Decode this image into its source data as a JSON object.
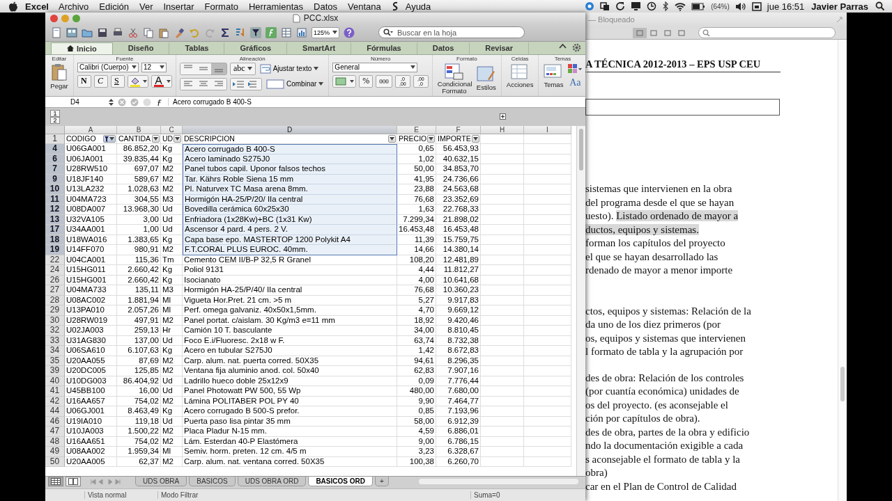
{
  "menubar": {
    "app": "Excel",
    "items": [
      "Archivo",
      "Edición",
      "Ver",
      "Insertar",
      "Formato",
      "Herramientas",
      "Datos",
      "Ventana",
      "Ayuda"
    ],
    "battery": "(64%)",
    "clock": "jue 16:51",
    "user": "Javier Parras"
  },
  "excel": {
    "title": "PCC.xlsx",
    "zoom": "125%",
    "search_placeholder": "Buscar en la hoja",
    "ribbon_tabs": [
      {
        "label": "Inicio",
        "selected": true
      },
      {
        "label": "Diseño",
        "selected": false
      },
      {
        "label": "Tablas",
        "selected": false
      },
      {
        "label": "Gráficos",
        "selected": false
      },
      {
        "label": "SmartArt",
        "selected": false
      },
      {
        "label": "Fórmulas",
        "selected": false
      },
      {
        "label": "Datos",
        "selected": false
      },
      {
        "label": "Revisar",
        "selected": false
      }
    ],
    "ribbon_groups": [
      {
        "kind": "edit",
        "label": "Editar",
        "paste": "Pegar"
      },
      {
        "kind": "font",
        "label": "Fuente",
        "font": "Calibri (Cuerpo)",
        "size": "12",
        "styles": [
          "N",
          "C",
          "S"
        ]
      },
      {
        "kind": "alignment",
        "label": "Alineación",
        "orientation": "abc",
        "wrap": "Ajustar texto",
        "merge": "Combinar"
      },
      {
        "kind": "number",
        "label": "Número",
        "format": "General",
        "percent": "%",
        "thousands": "000",
        "decimals": [
          {
            "top": ",0",
            "bottom": ",00"
          },
          {
            "top": ",00",
            "bottom": ",0"
          }
        ]
      },
      {
        "kind": "format",
        "label": "Formato",
        "conditional": "Condicional Formato",
        "styles": "Estilos"
      },
      {
        "kind": "cells",
        "label": "Celdas",
        "actions": "Acciones"
      },
      {
        "kind": "themes",
        "label": "Temas",
        "themes": "Temas",
        "fonts": "Aa"
      }
    ],
    "formula_bar": {
      "cell": "D4",
      "formula": "Acero corrugado B 400-S"
    },
    "outline_levels": [
      "1",
      "2"
    ],
    "columns": [
      {
        "letter": "A",
        "selected": false
      },
      {
        "letter": "B",
        "selected": false
      },
      {
        "letter": "C",
        "selected": false
      },
      {
        "letter": "D",
        "selected": true
      },
      {
        "letter": "E",
        "selected": false
      },
      {
        "letter": "F",
        "selected": false
      },
      {
        "letter": "H",
        "selected": false
      },
      {
        "letter": "I",
        "selected": false
      }
    ],
    "header_row": {
      "number": "1",
      "cells": [
        {
          "text": "CODIGO",
          "filtered": true
        },
        {
          "text": "CANTIDA",
          "filtered": false
        },
        {
          "text": "UD",
          "filtered": false
        },
        {
          "text": "DESCRIPCION",
          "filtered": false
        },
        {
          "text": "PRECIO",
          "filtered": false
        },
        {
          "text": "IMPORTE",
          "filtered": false
        }
      ]
    },
    "rows": [
      {
        "number": "4",
        "codigo": "U06GA001",
        "cantidad": "86.852,20",
        "ud": "Kg",
        "descripcion": "Acero corrugado B 400-S",
        "precio": "0,65",
        "importe": "56.453,93",
        "selected": true
      },
      {
        "number": "6",
        "codigo": "U06JA001",
        "cantidad": "39.835,44",
        "ud": "Kg",
        "descripcion": "Acero laminado S275J0",
        "precio": "1,02",
        "importe": "40.632,15",
        "selected": true
      },
      {
        "number": "7",
        "codigo": "U28RW510",
        "cantidad": "697,07",
        "ud": "M2",
        "descripcion": "Panel tubos capil. Uponor falsos techos",
        "precio": "50,00",
        "importe": "34.853,70",
        "selected": true
      },
      {
        "number": "9",
        "codigo": "U18JF140",
        "cantidad": "589,67",
        "ud": "M2",
        "descripcion": "Tar. Kährs Roble Siena 15 mm",
        "precio": "41,95",
        "importe": "24.736,66",
        "selected": true
      },
      {
        "number": "10",
        "codigo": "U13LA232",
        "cantidad": "1.028,63",
        "ud": "M2",
        "descripcion": "Pl. Naturvex TC Masa arena 8mm.",
        "precio": "23,88",
        "importe": "24.563,68",
        "selected": true
      },
      {
        "number": "11",
        "codigo": "U04MA723",
        "cantidad": "304,55",
        "ud": "M3",
        "descripcion": "Hormigón HA-25/P/20/ IIa central",
        "precio": "76,68",
        "importe": "23.352,69",
        "selected": true
      },
      {
        "number": "12",
        "codigo": "U08DA007",
        "cantidad": "13.968,30",
        "ud": "Ud",
        "descripcion": "Bovedilla cerámica 60x25x30",
        "precio": "1,63",
        "importe": "22.768,33",
        "selected": true
      },
      {
        "number": "13",
        "codigo": "U32VA105",
        "cantidad": "3,00",
        "ud": "Ud",
        "descripcion": "Enfriadora (1x28Kw)+BC (1x31 Kw)",
        "precio": "7.299,34",
        "importe": "21.898,02",
        "selected": true
      },
      {
        "number": "17",
        "codigo": "U34AA001",
        "cantidad": "1,00",
        "ud": "Ud",
        "descripcion": "Ascensor 4 pard. 4 pers. 2 V.",
        "precio": "16.453,48",
        "importe": "16.453,48",
        "selected": true
      },
      {
        "number": "18",
        "codigo": "U18WA016",
        "cantidad": "1.383,65",
        "ud": "Kg",
        "descripcion": "Capa base epo. MASTERTOP 1200 Polykit A4",
        "precio": "11,39",
        "importe": "15.759,75",
        "selected": true
      },
      {
        "number": "19",
        "codigo": "U14FF070",
        "cantidad": "980,91",
        "ud": "M2",
        "descripcion": "F.T.CORAL PLUS EUROC. 40mm.",
        "precio": "14,66",
        "importe": "14.380,14",
        "selected": true
      },
      {
        "number": "22",
        "codigo": "U04CA001",
        "cantidad": "115,36",
        "ud": "Tm",
        "descripcion": "Cemento CEM II/B-P 32,5 R Granel",
        "precio": "108,20",
        "importe": "12.481,89",
        "selected": false
      },
      {
        "number": "24",
        "codigo": "U15HG011",
        "cantidad": "2.660,42",
        "ud": "Kg",
        "descripcion": "Poliol 9131",
        "precio": "4,44",
        "importe": "11.812,27",
        "selected": false
      },
      {
        "number": "26",
        "codigo": "U15HG001",
        "cantidad": "2.660,42",
        "ud": "Kg",
        "descripcion": "Isocianato",
        "precio": "4,00",
        "importe": "10.641,68",
        "selected": false
      },
      {
        "number": "27",
        "codigo": "U04MA733",
        "cantidad": "135,11",
        "ud": "M3",
        "descripcion": "Hormigón HA-25/P/40/ IIa central",
        "precio": "76,68",
        "importe": "10.360,23",
        "selected": false
      },
      {
        "number": "28",
        "codigo": "U08AC002",
        "cantidad": "1.881,94",
        "ud": "Ml",
        "descripcion": "Vigueta Hor.Pret. 21 cm. >5 m",
        "precio": "5,27",
        "importe": "9.917,83",
        "selected": false
      },
      {
        "number": "29",
        "codigo": "U13PA010",
        "cantidad": "2.057,26",
        "ud": "Ml",
        "descripcion": "Perf. omega galvaniz. 40x50x1,5mm.",
        "precio": "4,70",
        "importe": "9.669,12",
        "selected": false
      },
      {
        "number": "30",
        "codigo": "U28RW019",
        "cantidad": "497,91",
        "ud": "M2",
        "descripcion": "Panel portat. c/aislam. 30 Kg/m3 e=11 mm",
        "precio": "18,92",
        "importe": "9.420,46",
        "selected": false
      },
      {
        "number": "32",
        "codigo": "U02JA003",
        "cantidad": "259,13",
        "ud": "Hr",
        "descripcion": "Camión 10  T. basculante",
        "precio": "34,00",
        "importe": "8.810,45",
        "selected": false
      },
      {
        "number": "33",
        "codigo": "U31AG830",
        "cantidad": "137,00",
        "ud": "Ud",
        "descripcion": "Foco E.i/Fluoresc. 2x18 w F.",
        "precio": "63,74",
        "importe": "8.732,38",
        "selected": false
      },
      {
        "number": "34",
        "codigo": "U06SA610",
        "cantidad": "6.107,63",
        "ud": "Kg",
        "descripcion": "Acero en tubular S275J0",
        "precio": "1,42",
        "importe": "8.672,83",
        "selected": false
      },
      {
        "number": "35",
        "codigo": "U20AA055",
        "cantidad": "87,69",
        "ud": "M2",
        "descripcion": "Carp. alum. nat. puerta corred. 50X35",
        "precio": "94,61",
        "importe": "8.296,35",
        "selected": false
      },
      {
        "number": "39",
        "codigo": "U20DC005",
        "cantidad": "125,85",
        "ud": "M2",
        "descripcion": "Ventana fija aluminio anod. col. 50x40",
        "precio": "62,83",
        "importe": "7.907,16",
        "selected": false
      },
      {
        "number": "40",
        "codigo": "U10DG003",
        "cantidad": "86.404,92",
        "ud": "Ud",
        "descripcion": "Ladrillo hueco doble 25x12x9",
        "precio": "0,09",
        "importe": "7.776,44",
        "selected": false
      },
      {
        "number": "41",
        "codigo": "U45BB100",
        "cantidad": "16,00",
        "ud": "Ud",
        "descripcion": "Panel Photowatt PW 500, 55 Wp",
        "precio": "480,00",
        "importe": "7.680,00",
        "selected": false
      },
      {
        "number": "42",
        "codigo": "U16AA657",
        "cantidad": "754,02",
        "ud": "M2",
        "descripcion": "Lámina POLITABER POL PY 40",
        "precio": "9,90",
        "importe": "7.464,77",
        "selected": false
      },
      {
        "number": "44",
        "codigo": "U06GJ001",
        "cantidad": "8.463,49",
        "ud": "Kg",
        "descripcion": "Acero corrugado B 500-S prefor.",
        "precio": "0,85",
        "importe": "7.193,96",
        "selected": false
      },
      {
        "number": "46",
        "codigo": "U19IA010",
        "cantidad": "119,18",
        "ud": "Ud",
        "descripcion": "Puerta paso lisa pintar 35 mm",
        "precio": "58,00",
        "importe": "6.912,39",
        "selected": false
      },
      {
        "number": "47",
        "codigo": "U10JA003",
        "cantidad": "1.500,22",
        "ud": "M2",
        "descripcion": "Placa Pladur N-15 mm.",
        "precio": "4,59",
        "importe": "6.886,01",
        "selected": false
      },
      {
        "number": "48",
        "codigo": "U16AA651",
        "cantidad": "754,02",
        "ud": "M2",
        "descripcion": "Lám. Esterdan 40-P Elastómera",
        "precio": "9,00",
        "importe": "6.786,15",
        "selected": false
      },
      {
        "number": "49",
        "codigo": "U08AA002",
        "cantidad": "1.959,34",
        "ud": "Ml",
        "descripcion": "Semiv. horm. preten. 12 cm. 4/5 m",
        "precio": "3,23",
        "importe": "6.328,67",
        "selected": false
      },
      {
        "number": "50",
        "codigo": "U20AA005",
        "cantidad": "62,37",
        "ud": "M2",
        "descripcion": "Carp. alum. nat. ventana corred. 50X35",
        "precio": "100,38",
        "importe": "6.260,70",
        "selected": false
      }
    ],
    "sheet_tabs": [
      {
        "label": "UDS OBRA",
        "selected": false
      },
      {
        "label": "BASICOS",
        "selected": false
      },
      {
        "label": "UDS OBRA ORD",
        "selected": false
      },
      {
        "label": "BASICOS ORD",
        "selected": true
      }
    ],
    "add_sheet": "+",
    "status_bar": {
      "view": "Vista normal",
      "mode": "Modo Filtrar",
      "sum": "Suma=0"
    }
  },
  "document": {
    "title": "— Bloqueado",
    "heading": "A TÉCNICA 2012-2013 – EPS USP CEU",
    "paragraphs": [
      {
        "lines": [
          [
            {
              "text": "sistemas que intervienen en la obra",
              "highlighted": false
            }
          ],
          [
            {
              "text": "del programa desde el que se hayan",
              "highlighted": false
            }
          ],
          [
            {
              "text": "uesto). ",
              "highlighted": false
            },
            {
              "text": "Listado ordenado de mayor a",
              "highlighted": true
            }
          ],
          [
            {
              "text": "ductos, equipos y sistemas.",
              "highlighted": true
            }
          ],
          [
            {
              "text": "forman los capítulos del  proyecto",
              "highlighted": false
            }
          ],
          [
            {
              "text": "el que se hayan desarrollado las",
              "highlighted": false
            }
          ],
          [
            {
              "text": "rdenado de mayor a menor importe",
              "highlighted": false
            }
          ]
        ]
      },
      {
        "lines": [
          [
            {
              "text": "ctos, equipos y sistemas: Relación de la",
              "highlighted": false
            }
          ],
          [
            {
              "text": "da uno de los diez primeros (por",
              "highlighted": false
            }
          ],
          [
            {
              "text": "os, equipos y sistemas que intervienen",
              "highlighted": false
            }
          ],
          [
            {
              "text": "l formato de tabla y la agrupación por",
              "highlighted": false
            }
          ]
        ]
      },
      {
        "lines": [
          [
            {
              "text": "des de obra: Relación de los controles",
              "highlighted": false
            }
          ],
          [
            {
              "text": "(por cuantía económica) unidades de",
              "highlighted": false
            }
          ],
          [
            {
              "text": "os del  proyecto. (es aconsejable el",
              "highlighted": false
            }
          ],
          [
            {
              "text": "ción por capítulos de obra).",
              "highlighted": false
            }
          ],
          [
            {
              "text": "des de obra, partes de la obra y edificio",
              "highlighted": false
            }
          ],
          [
            {
              "text": "ndo la documentación exigible a cada",
              "highlighted": false
            }
          ],
          [
            {
              "text": "s aconsejable el formato de tabla y la",
              "highlighted": false
            }
          ],
          [
            {
              "text": "obra)",
              "highlighted": false
            }
          ],
          [
            {
              "text": "car en el Plan de Control de Calidad",
              "highlighted": false
            }
          ]
        ]
      }
    ]
  }
}
